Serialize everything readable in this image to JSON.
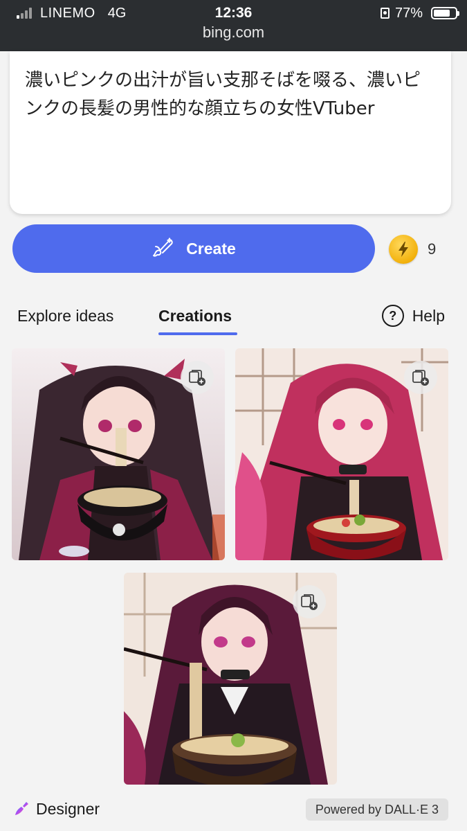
{
  "status_bar": {
    "carrier": "LINEMO",
    "network": "4G",
    "time": "12:36",
    "battery": "77%",
    "battery_level": 0.77
  },
  "url_bar": {
    "url": "bing.com"
  },
  "prompt": {
    "text": "濃いピンクの出汁が旨い支那そばを啜る、濃いピンクの長髪の男性的な顔立ちの女性VTuber"
  },
  "create": {
    "label": "Create",
    "boost_count": "9"
  },
  "tabs": [
    {
      "label": "Explore ideas",
      "active": false
    },
    {
      "label": "Creations",
      "active": true
    }
  ],
  "help": {
    "label": "Help"
  },
  "images": [
    {
      "subject": "anime-girl-eating-soba-dark-hair"
    },
    {
      "subject": "anime-girl-eating-soba-pink-hair"
    },
    {
      "subject": "anime-girl-eating-soba-purple-hair"
    }
  ],
  "footer": {
    "brand": "Designer",
    "powered_by": "Powered by DALL·E 3"
  },
  "colors": {
    "accent": "#4f6bed",
    "topbar": "#2b2e31",
    "background": "#f3f3f3",
    "coin": "#f2b10c"
  }
}
